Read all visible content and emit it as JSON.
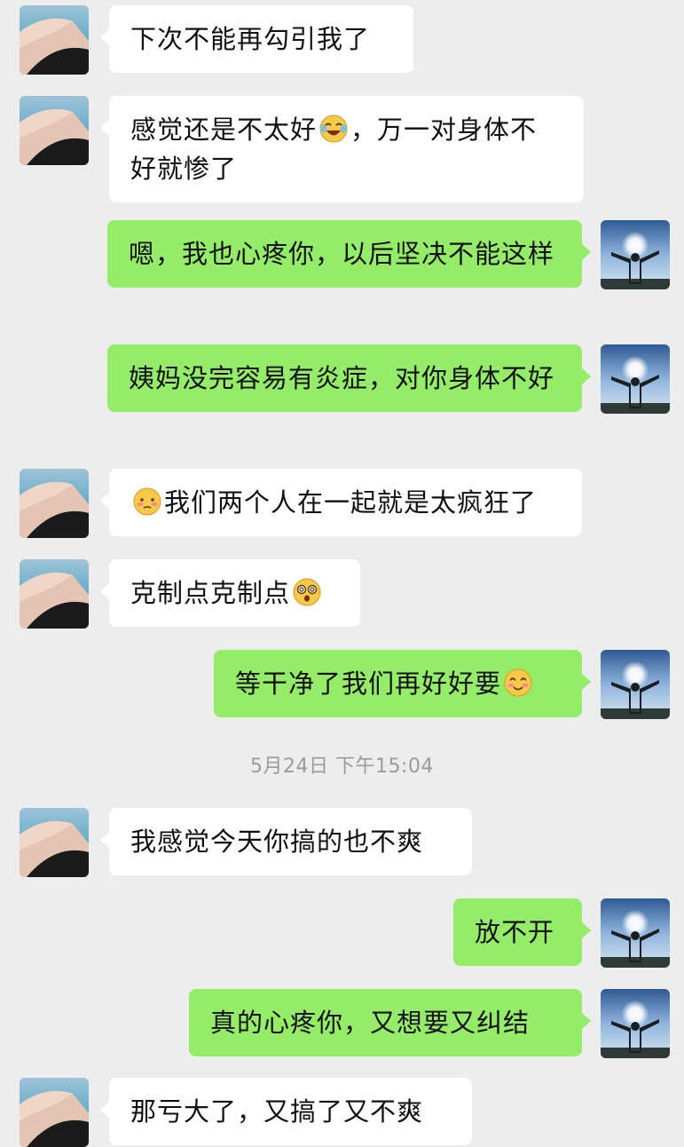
{
  "messages": [
    {
      "side": "left",
      "text": "下次不能再勾引我了"
    },
    {
      "side": "left",
      "text_before": "感觉还是不太好",
      "emoji": "laughing-tears-emoji",
      "text_after": "，万一对身体不好就惨了"
    },
    {
      "side": "right",
      "text": "嗯，我也心疼你，以后坚决不能这样"
    },
    {
      "side": "right",
      "text": "姨妈没完容易有炎症，对你身体不好"
    },
    {
      "side": "left",
      "emoji": "shy-blush-emoji",
      "text_after": "我们两个人在一起就是太疯狂了"
    },
    {
      "side": "left",
      "text_before": "克制点克制点",
      "emoji": "dizzy-face-emoji"
    },
    {
      "side": "right",
      "text_before": "等干净了我们再好好要",
      "emoji": "shy-smile-emoji"
    },
    {
      "side": "left",
      "text": "我感觉今天你搞的也不爽"
    },
    {
      "side": "right",
      "text": "放不开"
    },
    {
      "side": "right",
      "text": "真的心疼你，又想要又纠结"
    },
    {
      "side": "left",
      "text": "那亏大了，又搞了又不爽"
    }
  ],
  "timestamp": "5月24日 下午15:04",
  "colors": {
    "background": "#ededed",
    "incoming_bubble": "#ffffff",
    "outgoing_bubble": "#95ec69",
    "timestamp_text": "#9a9a9a"
  }
}
